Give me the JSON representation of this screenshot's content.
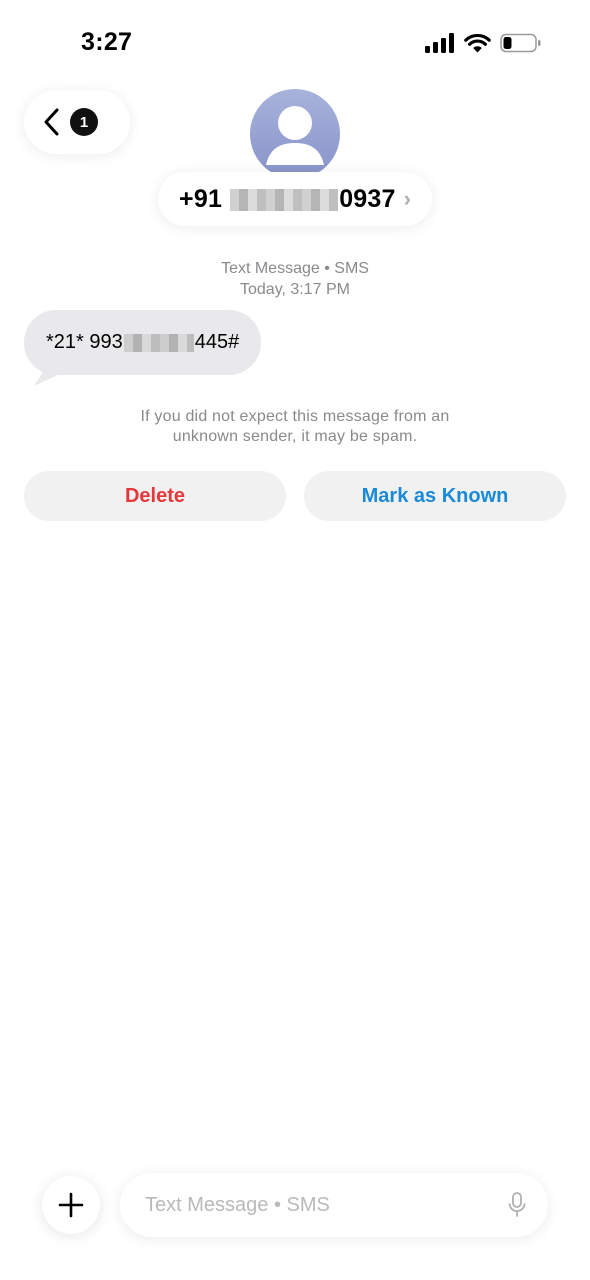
{
  "status_bar": {
    "time": "3:27",
    "icons": [
      "signal-icon",
      "wifi-icon",
      "battery-icon"
    ]
  },
  "nav": {
    "unread_count": "1",
    "back_icon": "chevron-left-icon"
  },
  "contact": {
    "name_prefix": "+91 ",
    "name_suffix": "0937",
    "avatar_icon": "person-silhouette-icon"
  },
  "thread": {
    "service_line": "Text Message • SMS",
    "date_line": "Today, 3:17 PM"
  },
  "message": {
    "text_prefix": "*21* 993",
    "text_suffix": "445#"
  },
  "spam_notice": {
    "line1": "If you did not expect this message from an",
    "line2": "unknown sender, it may be spam."
  },
  "actions": {
    "delete_label": "Delete",
    "mark_known_label": "Mark as Known"
  },
  "composer": {
    "placeholder": "Text Message • SMS",
    "plus_icon": "plus-icon",
    "mic_icon": "microphone-icon"
  },
  "colors": {
    "delete": "#e5383b",
    "mark_known": "#1a8ad8",
    "bubble": "#e9e9eb",
    "secondary_text": "#8a8a8e"
  }
}
